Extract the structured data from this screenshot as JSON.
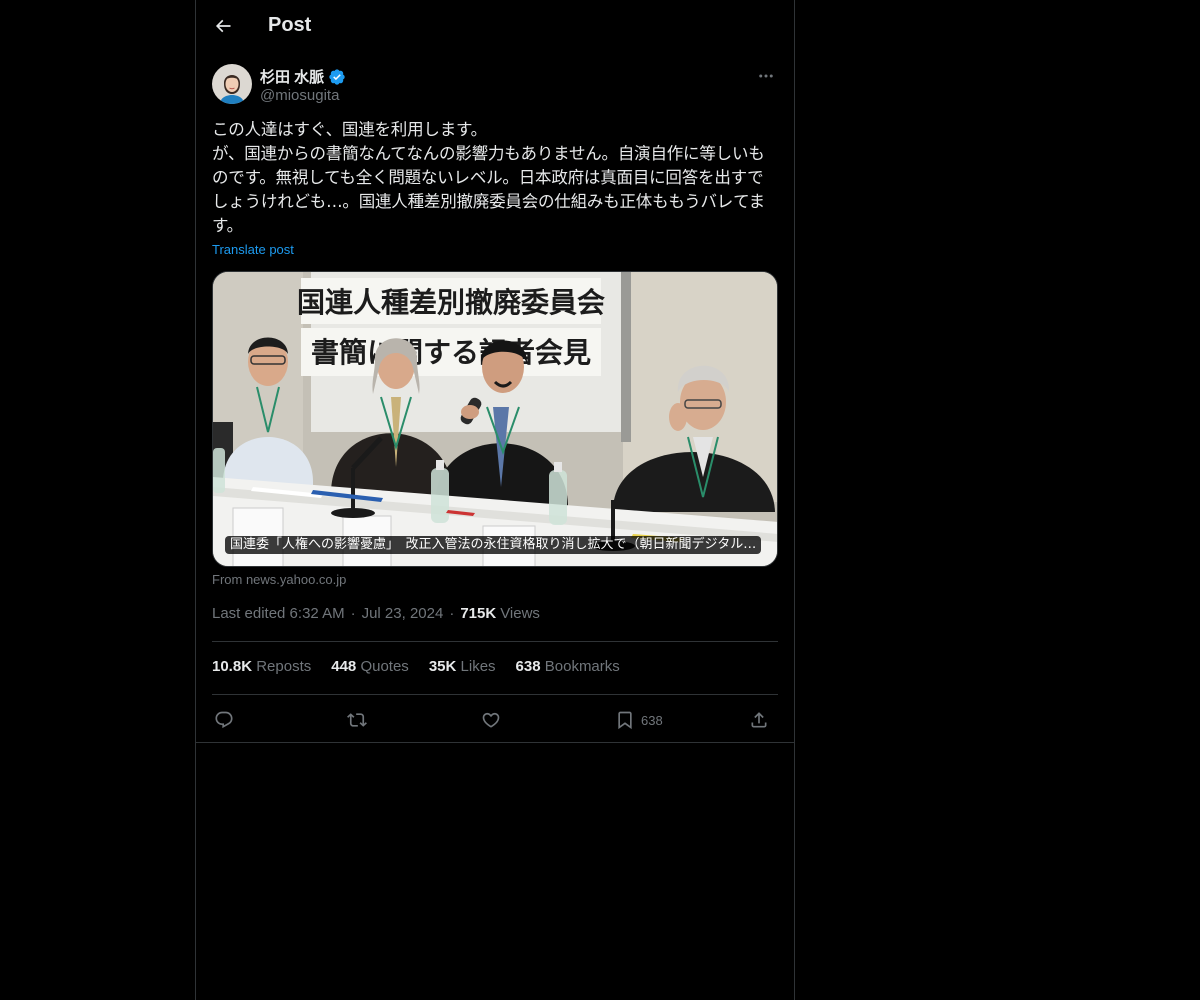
{
  "header": {
    "title": "Post",
    "back_icon": "arrow-left-icon"
  },
  "author": {
    "display_name": "杉田 水脈",
    "handle": "@miosugita",
    "verified": true,
    "verified_color": "#1d9bf0"
  },
  "post": {
    "text": "この人達はすぐ、国連を利用します。\nが、国連からの書簡なんてなんの影響力もありません。自演自作に等しいものです。無視しても全く問題ないレベル。日本政府は真面目に回答を出すでしょうけれども…。国連人種差別撤廃委員会の仕組みも正体ももうバレてます。",
    "translate_label": "Translate post"
  },
  "media": {
    "caption": "国連委「人権への影響憂慮」　改正入管法の永住資格取り消し拡大で（朝日新聞デジタル…",
    "banner_line1": "国連人種差別撤廃委員会",
    "banner_line2": "書簡に関する記者会見",
    "source": "From news.yahoo.co.jp"
  },
  "meta": {
    "edited": "Last edited 6:32 AM",
    "date": "Jul 23, 2024",
    "views_count": "715K",
    "views_label": "Views"
  },
  "stats": [
    {
      "num": "10.8K",
      "label": "Reposts"
    },
    {
      "num": "448",
      "label": "Quotes"
    },
    {
      "num": "35K",
      "label": "Likes"
    },
    {
      "num": "638",
      "label": "Bookmarks"
    }
  ],
  "actions": {
    "reply_icon": "reply-icon",
    "repost_icon": "repost-icon",
    "like_icon": "heart-icon",
    "bookmark_icon": "bookmark-icon",
    "bookmark_count": "638",
    "share_icon": "share-icon"
  },
  "colors": {
    "background": "#000000",
    "text_primary": "#e7e9ea",
    "text_secondary": "#71767b",
    "accent": "#1d9bf0",
    "border": "#2f3336"
  }
}
